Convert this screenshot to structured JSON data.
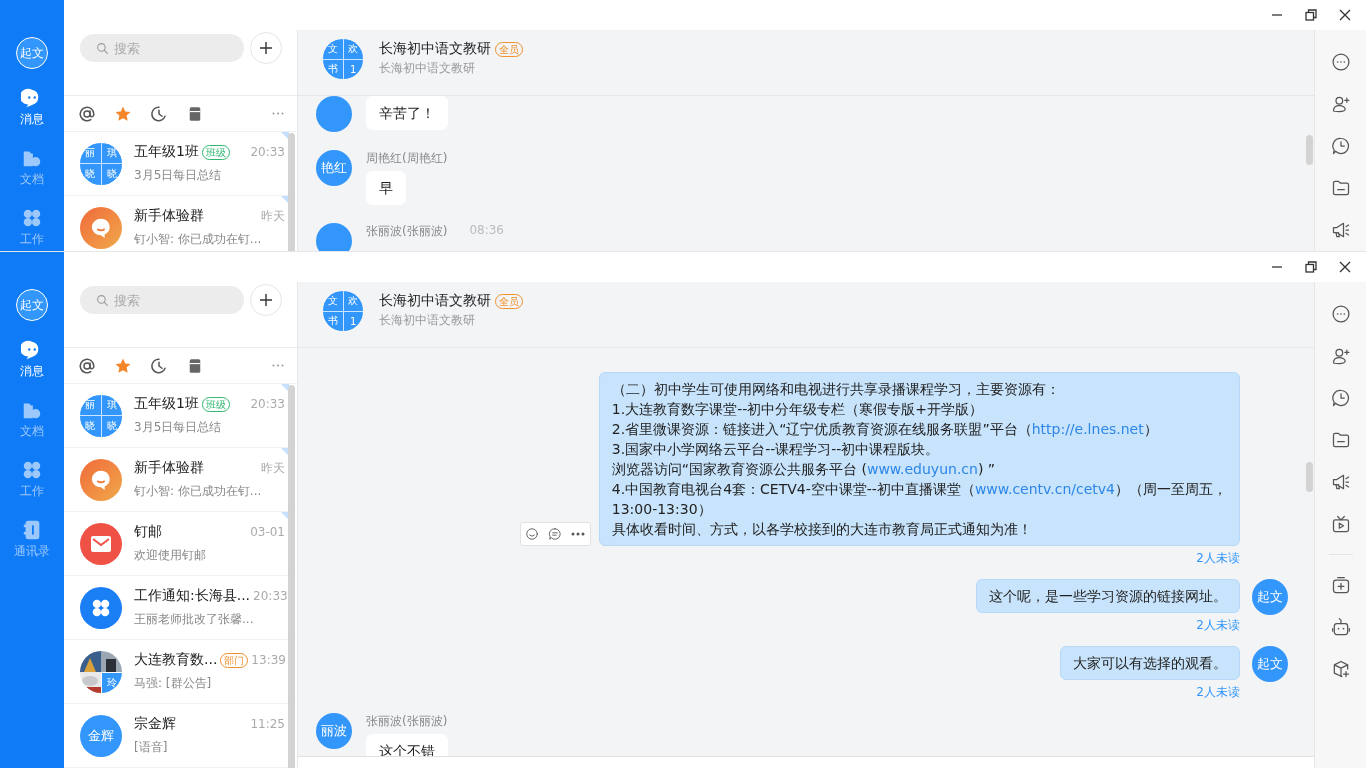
{
  "windows": [
    {
      "user": "起文",
      "nav": [
        {
          "label": "消息",
          "kind": "chat",
          "selected": true
        },
        {
          "label": "文档",
          "kind": "docs",
          "selected": false
        },
        {
          "label": "工作",
          "kind": "work",
          "selected": false
        }
      ],
      "search": {
        "placeholder": "搜索"
      },
      "filters": [
        {
          "kind": "mention",
          "selected": false
        },
        {
          "kind": "star",
          "selected": true
        },
        {
          "kind": "recent",
          "selected": false
        },
        {
          "kind": "archive",
          "selected": false
        }
      ],
      "conversations": [
        {
          "avatar": {
            "kind": "grid",
            "chars": [
              "丽",
              "琪",
              "晓",
              "晓"
            ]
          },
          "name": "五年级1班",
          "tag": {
            "text": "班级",
            "color": "#2eb872"
          },
          "time": "20:33",
          "preview": "3月5日每日总结",
          "pinned": true
        },
        {
          "avatar": {
            "kind": "hi"
          },
          "name": "新手体验群",
          "time": "昨天",
          "preview": "钉小智: 你已成功在钉...",
          "pinned": true
        }
      ],
      "chat": {
        "avatar": [
          "文",
          "欢",
          "书",
          "1"
        ],
        "title": "长海初中语文教研",
        "tag": "全员",
        "subtitle": "长海初中语文教研",
        "messages": [
          {
            "kind": "incoming",
            "text": "辛苦了！"
          },
          {
            "kind": "incoming",
            "avatar": "艳红",
            "sender": "周艳红(周艳红)",
            "text": "早"
          },
          {
            "kind": "incoming",
            "sender": "张丽波(张丽波)",
            "time": "08:36"
          }
        ]
      },
      "toolbar": [
        {
          "kind": "more"
        },
        {
          "kind": "add-member"
        },
        {
          "kind": "history"
        },
        {
          "kind": "folder"
        },
        {
          "kind": "megaphone"
        }
      ]
    },
    {
      "user": "起文",
      "nav": [
        {
          "label": "消息",
          "kind": "chat",
          "selected": true
        },
        {
          "label": "文档",
          "kind": "docs",
          "selected": false
        },
        {
          "label": "工作",
          "kind": "work",
          "selected": false
        },
        {
          "label": "通讯录",
          "kind": "contacts",
          "selected": false
        }
      ],
      "search": {
        "placeholder": "搜索"
      },
      "filters": [
        {
          "kind": "mention",
          "selected": false
        },
        {
          "kind": "star",
          "selected": true
        },
        {
          "kind": "recent",
          "selected": false
        },
        {
          "kind": "archive",
          "selected": false
        }
      ],
      "conversations": [
        {
          "avatar": {
            "kind": "grid",
            "chars": [
              "丽",
              "琪",
              "晓",
              "晓"
            ]
          },
          "name": "五年级1班",
          "tag": {
            "text": "班级",
            "color": "#2eb872"
          },
          "time": "20:33",
          "preview": "3月5日每日总结",
          "pinned": true
        },
        {
          "avatar": {
            "kind": "hi"
          },
          "name": "新手体验群",
          "time": "昨天",
          "preview": "钉小智: 你已成功在钉...",
          "pinned": true
        },
        {
          "avatar": {
            "kind": "mail"
          },
          "name": "钉邮",
          "time": "03-01",
          "preview": "欢迎使用钉邮",
          "pinned": true
        },
        {
          "avatar": {
            "kind": "work"
          },
          "name": "工作通知:长海县...",
          "time": "20:33",
          "preview": "王丽老师批改了张馨...",
          "pinned": false
        },
        {
          "avatar": {
            "chars": [
              "玲"
            ]
          },
          "name": "大连教育数...",
          "tag": {
            "text": "部门",
            "color": "#f0912d"
          },
          "time": "13:39",
          "preview": "马强: [群公告]",
          "pinned": false
        },
        {
          "avatar": {
            "kind": "text",
            "chars": [
              "金辉"
            ]
          },
          "name": "宗金辉",
          "time": "11:25",
          "preview": "[语音]",
          "pinned": false
        }
      ],
      "chat": {
        "avatar": [
          "文",
          "欢",
          "书",
          "1"
        ],
        "title": "长海初中语文教研",
        "tag": "全员",
        "subtitle": "长海初中语文教研",
        "messages": [
          {
            "kind": "outgoing",
            "actions": true,
            "status": "2人未读",
            "lines": [
              [
                {
                  "text": "（二）初中学生可使用网络和电视进行共享录播课程学习，主要资源有："
                }
              ],
              [
                {
                  "text": "1.大连教育数字课堂--初中分年级专栏（寒假专版+开学版）"
                }
              ],
              [
                {
                  "text": "2.省里微课资源：链接进入“辽宁优质教育资源在线服务联盟”平台（"
                },
                {
                  "text": "http://e.lnes.net",
                  "link": true
                },
                {
                  "text": "）"
                }
              ],
              [
                {
                  "text": "3.国家中小学网络云平台--课程学习--初中课程版块。"
                }
              ],
              [
                {
                  "text": "浏览器访问“国家教育资源公共服务平台 ("
                },
                {
                  "text": "www.eduyun.cn",
                  "link": true
                },
                {
                  "text": ") ”"
                }
              ],
              [
                {
                  "text": "4.中国教育电视台4套：CETV4-空中课堂--初中直播课堂（"
                },
                {
                  "text": "www.centv.cn/cetv4",
                  "link": true
                },
                {
                  "text": "）（周一至周五，"
                }
              ],
              [
                {
                  "text": "13:00-13:30）"
                }
              ],
              [
                {
                  "text": "具体收看时间、方式，以各学校接到的大连市教育局正式通知为准！"
                }
              ]
            ]
          },
          {
            "kind": "outgoing",
            "avatar": "起文",
            "status": "2人未读",
            "lines": [
              [
                {
                  "text": "这个呢，是一些学习资源的链接网址。"
                }
              ]
            ]
          },
          {
            "kind": "outgoing",
            "avatar": "起文",
            "status": "2人未读",
            "lines": [
              [
                {
                  "text": "大家可以有选择的观看。"
                }
              ]
            ]
          },
          {
            "kind": "incoming",
            "avatar": "丽波",
            "sender": "张丽波(张丽波)",
            "text": "这个不错"
          }
        ]
      },
      "toolbar": [
        {
          "kind": "more"
        },
        {
          "kind": "add-member"
        },
        {
          "kind": "history"
        },
        {
          "kind": "folder"
        },
        {
          "kind": "megaphone"
        },
        {
          "kind": "tv"
        },
        {
          "kind": "divider"
        },
        {
          "kind": "add-app"
        },
        {
          "kind": "robot"
        },
        {
          "kind": "box-add"
        }
      ]
    }
  ]
}
